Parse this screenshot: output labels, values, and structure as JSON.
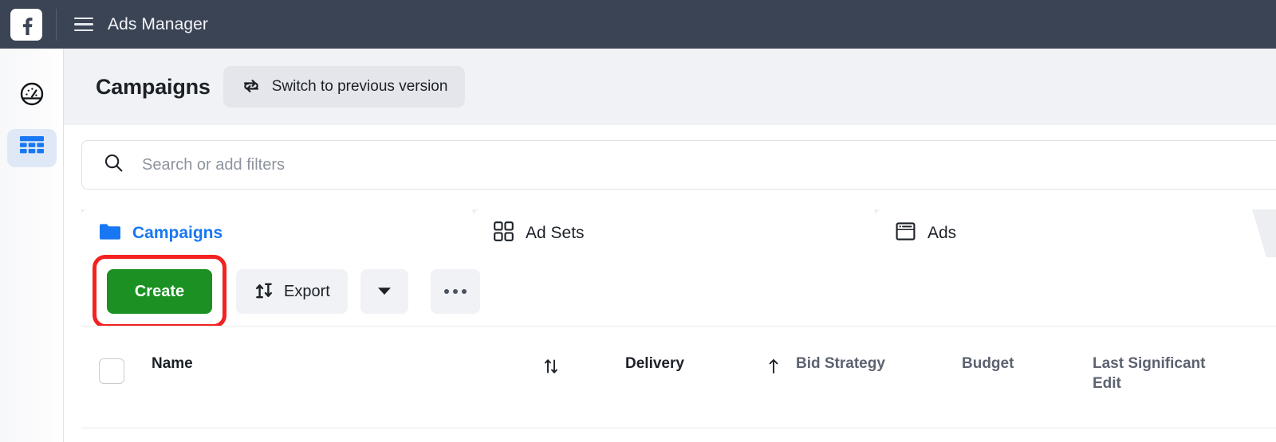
{
  "topbar": {
    "logo_icon": "facebook-logo-icon",
    "menu_icon": "hamburger-menu-icon",
    "title": "Ads Manager"
  },
  "sidebar": {
    "items": [
      {
        "icon": "speedometer-icon",
        "name": "performance",
        "active": false
      },
      {
        "icon": "table-grid-icon",
        "name": "campaigns-table",
        "active": true
      }
    ]
  },
  "page_header": {
    "title": "Campaigns",
    "switch_button": {
      "label": "Switch to previous version",
      "icon": "swap-arrows-icon"
    }
  },
  "search": {
    "icon": "search-icon",
    "placeholder": "Search or add filters",
    "value": ""
  },
  "tabs": [
    {
      "label": "Campaigns",
      "icon": "folder-icon",
      "active": true
    },
    {
      "label": "Ad Sets",
      "icon": "grid-2x2-icon",
      "active": false
    },
    {
      "label": "Ads",
      "icon": "window-icon",
      "active": false
    }
  ],
  "toolbar": {
    "create_label": "Create",
    "export_label": "Export",
    "export_icon": "up-down-arrows-icon",
    "caret_icon": "chevron-down-icon",
    "more_icon": "ellipsis-icon",
    "highlight_color": "#f42121",
    "create_color": "#1a9122"
  },
  "table": {
    "select_all_checkbox": "unchecked",
    "columns": [
      {
        "label": "Name",
        "emphasis": "strong"
      },
      {
        "label": "Delivery",
        "emphasis": "strong"
      },
      {
        "label": "Bid Strategy",
        "emphasis": "normal"
      },
      {
        "label": "Budget",
        "emphasis": "normal"
      },
      {
        "label": "Last Significant Edit",
        "emphasis": "normal"
      }
    ],
    "sort_icons": [
      {
        "name": "sort-updown-icon"
      },
      {
        "name": "sort-up-icon"
      }
    ]
  },
  "colors": {
    "topbar_bg": "#3b4455",
    "brand_blue": "#1877f2",
    "page_bg": "#f0f2f5"
  }
}
